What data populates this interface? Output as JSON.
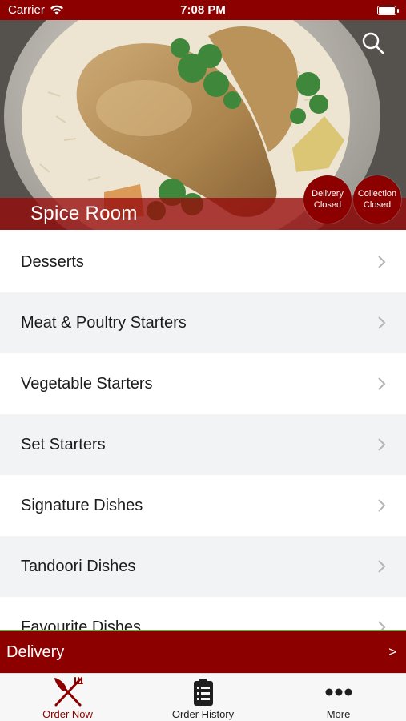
{
  "status_bar": {
    "carrier": "Carrier",
    "time": "7:08 PM"
  },
  "hero": {
    "restaurant_name": "Spice Room",
    "search_icon": "search-icon",
    "delivery_status": {
      "line1": "Delivery",
      "line2": "Closed"
    },
    "collection_status": {
      "line1": "Collection",
      "line2": "Closed"
    }
  },
  "menu": {
    "items": [
      {
        "label": "Desserts"
      },
      {
        "label": "Meat & Poultry Starters"
      },
      {
        "label": "Vegetable Starters"
      },
      {
        "label": "Set Starters"
      },
      {
        "label": "Signature Dishes"
      },
      {
        "label": "Tandoori Dishes"
      },
      {
        "label": "Favourite Dishes"
      }
    ]
  },
  "delivery_bar": {
    "label": "Delivery",
    "arrow": ">"
  },
  "tabs": [
    {
      "label": "Order Now",
      "icon": "fork-knife-icon",
      "active": true
    },
    {
      "label": "Order History",
      "icon": "clipboard-icon",
      "active": false
    },
    {
      "label": "More",
      "icon": "ellipsis-icon",
      "active": false
    }
  ],
  "colors": {
    "brand": "#8c0000",
    "accent_green": "#6aa84f",
    "row_alt": "#f2f3f4"
  }
}
